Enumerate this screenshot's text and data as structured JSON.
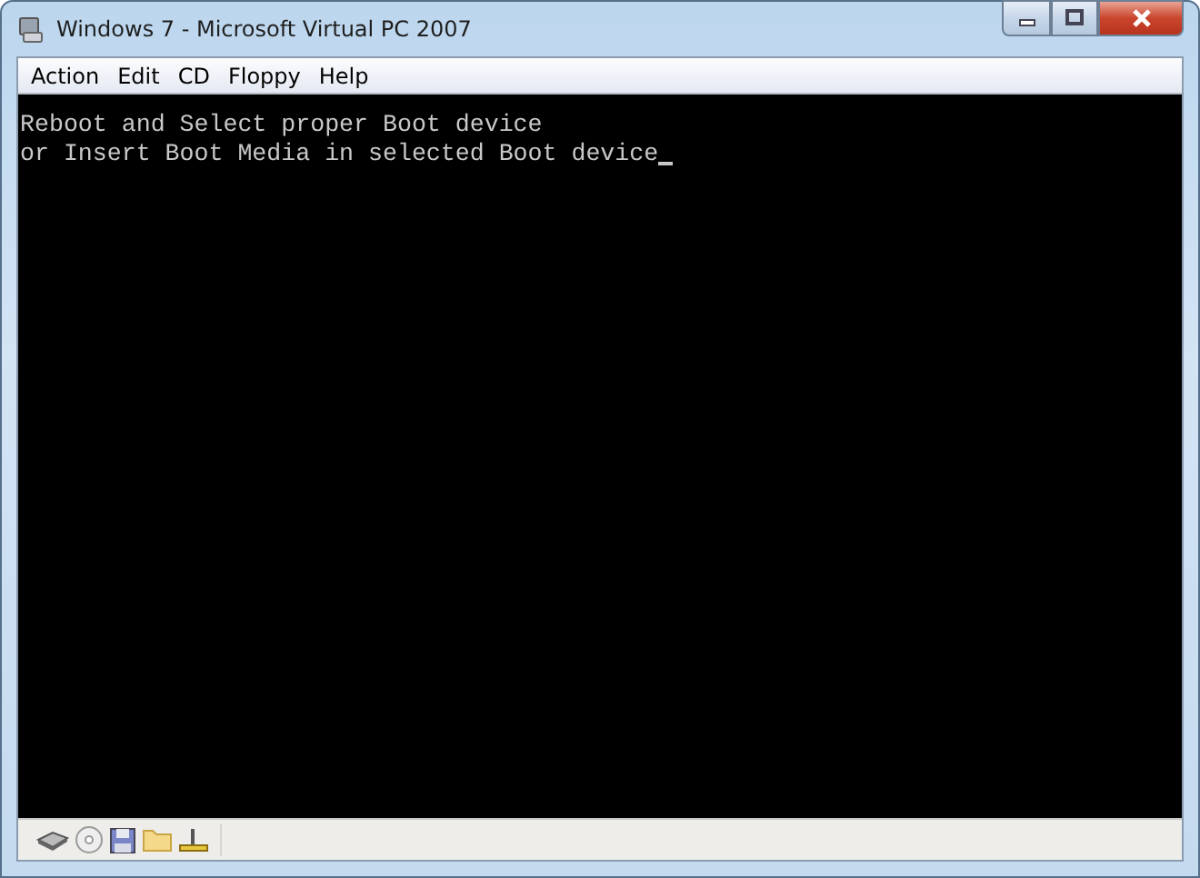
{
  "window": {
    "title": "Windows 7 - Microsoft Virtual PC 2007"
  },
  "menu": [
    {
      "label": "Action"
    },
    {
      "label": "Edit"
    },
    {
      "label": "CD"
    },
    {
      "label": "Floppy"
    },
    {
      "label": "Help"
    }
  ],
  "console": {
    "lines": [
      "Reboot and Select proper Boot device",
      "or Insert Boot Media in selected Boot device"
    ],
    "cursor_visible": true
  }
}
